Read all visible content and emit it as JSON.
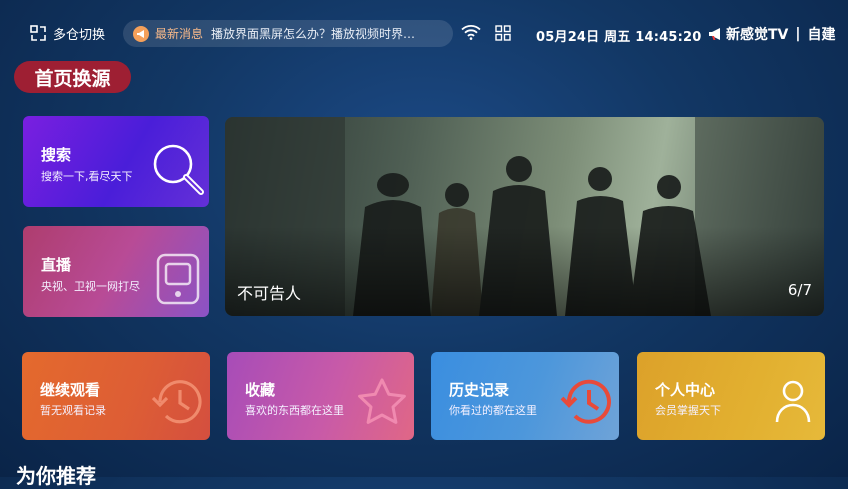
{
  "topbar": {
    "workspace_label": "多仓切换",
    "ticker_tag": "最新消息",
    "ticker_text": "播放界面黑屏怎么办？播放视频时界…",
    "datetime": "05月24日 周五 14:45:20",
    "brand": "新感觉TV",
    "brand_separator": "|",
    "brand_suffix": "自建"
  },
  "section": {
    "title": "首页换源"
  },
  "tiles": {
    "search": {
      "title": "搜索",
      "subtitle": "搜索一下,看尽天下",
      "icon": "magnifier-icon"
    },
    "live": {
      "title": "直播",
      "subtitle": "央视、卫视一网打尽",
      "icon": "tv-icon"
    }
  },
  "banner": {
    "caption": "不可告人",
    "pager": "6/7"
  },
  "cards": [
    {
      "title": "继续观看",
      "subtitle": "暂无观看记录",
      "icon": "history-icon"
    },
    {
      "title": "收藏",
      "subtitle": "喜欢的东西都在这里",
      "icon": "star-icon"
    },
    {
      "title": "历史记录",
      "subtitle": "你看过的都在这里",
      "icon": "history-icon"
    },
    {
      "title": "个人中心",
      "subtitle": "会员掌握天下",
      "icon": "user-icon"
    }
  ],
  "recommend": {
    "title": "为你推荐"
  },
  "colors": {
    "section_badge": "#9e1f33",
    "search_tile": "#5a1ee0",
    "live_tile": "#b84b96",
    "continue_card": "#e0643a",
    "favorite_card": "#c85aa8",
    "history_card": "#4d97db",
    "profile_card": "#e2b030",
    "history_icon_red": "#e84a3a"
  }
}
